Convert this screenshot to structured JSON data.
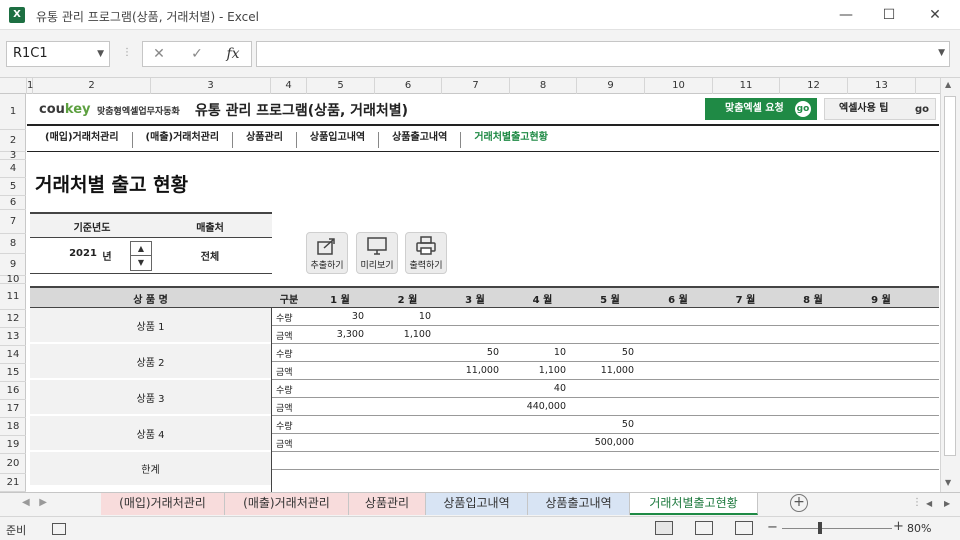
{
  "window": {
    "app_icon": "X",
    "title": "유통 관리 프로그램(상품, 거래처별)  -  Excel",
    "minimize": "—",
    "maximize": "☐",
    "close": "✕"
  },
  "formula_bar": {
    "name_box": "R1C1",
    "fx_label": "fx",
    "cancel": "✕",
    "enter": "✓",
    "formula": ""
  },
  "columns": [
    "1",
    "2",
    "3",
    "4",
    "5",
    "6",
    "7",
    "8",
    "9",
    "10",
    "11",
    "12",
    "13"
  ],
  "rows": [
    "1",
    "2",
    "3",
    "4",
    "5",
    "6",
    "7",
    "8",
    "9",
    "10",
    "11",
    "12",
    "13",
    "14",
    "15",
    "16",
    "17",
    "18",
    "19",
    "20",
    "21"
  ],
  "header": {
    "logo_co": "cou",
    "logo_key": "key",
    "logo_sub": "맞춤형엑셀업무자동화",
    "program_title": "유통 관리 프로그램(상품, 거래처별)",
    "request_button": "맞춤엑셀 요청",
    "tip_button": "엑셀사용 팁",
    "go": "go"
  },
  "nav": [
    "(매입)거래처관리",
    "(매출)거래처관리",
    "상품관리",
    "상품입고내역",
    "상품출고내역",
    "거래처별출고현황"
  ],
  "page_title": "거래처별 출고 현황",
  "criteria": {
    "year_label": "기준년도",
    "client_label": "매출처",
    "year_value": "2021",
    "year_unit": "년",
    "client_value": "전체"
  },
  "actions": [
    "추출하기",
    "미리보기",
    "출력하기"
  ],
  "table": {
    "headers": {
      "product": "상 품 명",
      "kind": "구분",
      "months": [
        "1 월",
        "2 월",
        "3 월",
        "4 월",
        "5 월",
        "6 월",
        "7 월",
        "8 월",
        "9 월"
      ]
    },
    "qty_label": "수량",
    "amount_label": "금액",
    "products": [
      {
        "name": "상품 1",
        "qty": [
          "30",
          "10",
          "",
          "",
          "",
          "",
          "",
          "",
          ""
        ],
        "amount": [
          "3,300",
          "1,100",
          "",
          "",
          "",
          "",
          "",
          "",
          ""
        ]
      },
      {
        "name": "상품 2",
        "qty": [
          "",
          "",
          "50",
          "10",
          "50",
          "",
          "",
          "",
          ""
        ],
        "amount": [
          "",
          "",
          "11,000",
          "1,100",
          "11,000",
          "",
          "",
          "",
          ""
        ]
      },
      {
        "name": "상품 3",
        "qty": [
          "",
          "",
          "",
          "40",
          "",
          "",
          "",
          "",
          ""
        ],
        "amount": [
          "",
          "",
          "",
          "440,000",
          "",
          "",
          "",
          "",
          ""
        ]
      },
      {
        "name": "상품 4",
        "qty": [
          "",
          "",
          "",
          "",
          "50",
          "",
          "",
          "",
          ""
        ],
        "amount": [
          "",
          "",
          "",
          "",
          "500,000",
          "",
          "",
          "",
          ""
        ]
      }
    ],
    "total_label": "한계"
  },
  "tabs": [
    {
      "label": "(매입)거래처관리",
      "style": "red"
    },
    {
      "label": "(매출)거래처관리",
      "style": "red"
    },
    {
      "label": "상품관리",
      "style": "red"
    },
    {
      "label": "상품입고내역",
      "style": "blue"
    },
    {
      "label": "상품출고내역",
      "style": "blue"
    },
    {
      "label": "거래처별출고현황",
      "style": "active"
    }
  ],
  "status": {
    "ready": "준비",
    "zoom": "80%",
    "zoom_minus": "−",
    "zoom_plus": "+"
  },
  "colors": {
    "accent_green": "#1f8a45",
    "tab_red": "#f8dcdc",
    "tab_blue": "#d8e4f4"
  }
}
